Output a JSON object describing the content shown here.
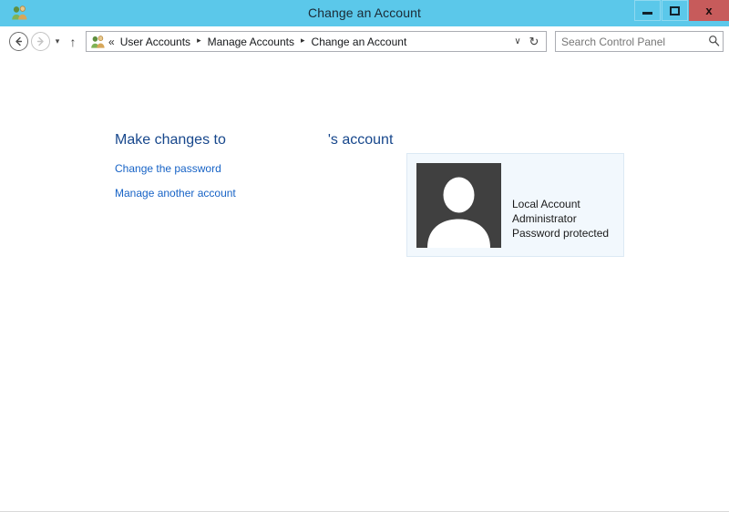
{
  "window": {
    "title": "Change an Account",
    "icon": "user-accounts-icon",
    "frame_color": "#5bc8ea",
    "close_color": "#c75b5b",
    "controls": {
      "minimize": "–",
      "maximize": "□",
      "close": "x"
    }
  },
  "navigation": {
    "back": "←",
    "forward": "→",
    "recent_chevron": "▾",
    "up": "↑",
    "address_dropdown": "∨",
    "refresh": "↻",
    "overflow": "«",
    "separator": "▸",
    "breadcrumbs": [
      "User Accounts",
      "Manage Accounts",
      "Change an Account"
    ]
  },
  "search": {
    "placeholder": "Search Control Panel",
    "value": "",
    "icon": "search-icon"
  },
  "main": {
    "heading_prefix": "Make changes to",
    "heading_user": "",
    "heading_suffix": "'s account",
    "links": [
      {
        "label": "Change the password"
      },
      {
        "label": "Manage another account"
      }
    ],
    "account": {
      "avatar": "user-silhouette-icon",
      "avatar_bg": "#404040",
      "lines": [
        "Local Account",
        "Administrator",
        "Password protected"
      ],
      "type": "Local Account",
      "role": "Administrator",
      "password_status": "Password protected"
    }
  }
}
